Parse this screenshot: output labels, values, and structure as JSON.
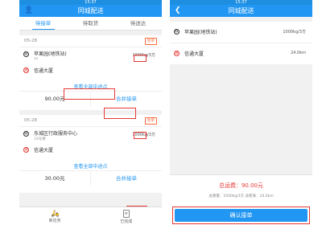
{
  "left": {
    "status_time": "15:37",
    "nav_title": "同城配送",
    "tabs": [
      "待接单",
      "待取货",
      "待送达"
    ],
    "orders": [
      {
        "date": "05-28",
        "badge": "抢单",
        "pickup": "苹果园(地铁站)",
        "pickup_sub": "xx",
        "weight": "1000kg/3方",
        "deliver": "信通大厦",
        "view_all": "查看全部中途点",
        "price": "90.00元",
        "merge": "合并接单"
      },
      {
        "date": "05-28",
        "badge": "抢单",
        "pickup": "东城区行政服务中心",
        "pickup_sub": "33号楼",
        "weight": "1000kg/3方",
        "deliver": "信通大厦",
        "view_all": "查看全部中途点",
        "price": "30.00元",
        "merge": "合并接单"
      }
    ],
    "bottom_nav": [
      "新任务",
      "已完成"
    ]
  },
  "right": {
    "status_time": "15:37",
    "nav_title": "同城配送",
    "pickup": "苹果园(地铁站)",
    "weight": "1000kg/3方",
    "deliver": "信通大厦",
    "distance": "24.0km",
    "total": "总运费：90.00元",
    "summary": "总重量：1000kg/3方 总距离：24.0km",
    "confirm": "确认接单"
  },
  "colors": {
    "primary": "#2196f3",
    "highlight": "#e53935",
    "badge": "#ff6a3c"
  }
}
